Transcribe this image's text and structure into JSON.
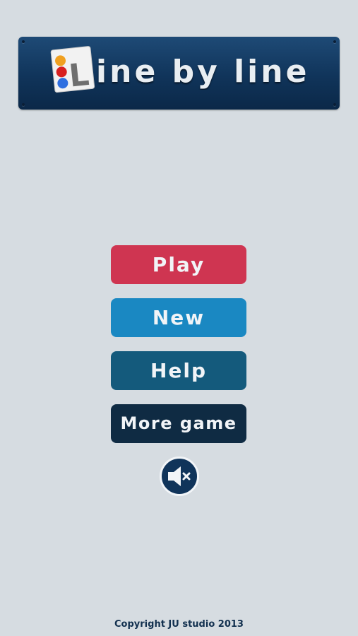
{
  "header": {
    "logo_text": "Line by line",
    "logo_icon": "colored-dots-card-icon"
  },
  "menu": {
    "play_label": "Play",
    "new_label": "New",
    "help_label": "Help",
    "more_label": "More game"
  },
  "sound": {
    "icon": "speaker-muted-icon",
    "state": "muted"
  },
  "footer": {
    "copyright": "Copyright JU studio 2013"
  },
  "colors": {
    "background": "#d6dce1",
    "banner": "#10345a",
    "play": "#cf3551",
    "new": "#1a88c2",
    "help": "#145a7c",
    "more": "#0f2b43"
  }
}
